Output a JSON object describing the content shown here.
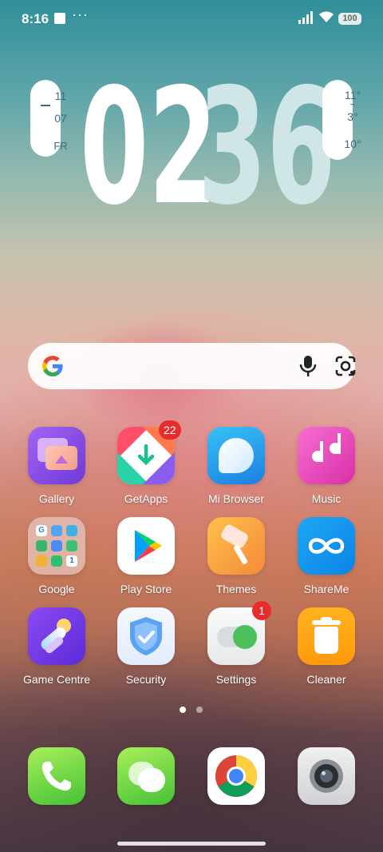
{
  "status_bar": {
    "time": "8:16",
    "more": "···",
    "battery": "100"
  },
  "clock_widget": {
    "date_month": "11",
    "date_day": "07",
    "weekday": "FR",
    "hour": "02",
    "minute": "36",
    "temp_high": "11°",
    "temp_sep": "~",
    "temp_low": "3°",
    "temp_now": "10°"
  },
  "search_bar": {
    "icons": [
      "google-logo",
      "mic-icon",
      "lens-icon"
    ]
  },
  "apps": [
    {
      "label": "Gallery"
    },
    {
      "label": "GetApps",
      "badge": "22"
    },
    {
      "label": "Mi Browser"
    },
    {
      "label": "Music"
    },
    {
      "label": "Google"
    },
    {
      "label": "Play Store"
    },
    {
      "label": "Themes"
    },
    {
      "label": "ShareMe"
    },
    {
      "label": "Game Centre"
    },
    {
      "label": "Security"
    },
    {
      "label": "Settings",
      "badge": "1"
    },
    {
      "label": "Cleaner"
    }
  ],
  "dock": [
    {
      "icon": "phone-icon"
    },
    {
      "icon": "messages-icon"
    },
    {
      "icon": "chrome-icon"
    },
    {
      "icon": "camera-icon"
    }
  ],
  "page_indicator": {
    "pages": 2,
    "active": 1
  },
  "colors": {
    "badge": "#e82b2b",
    "clock_hour": "#ffffff",
    "clock_minute": "#cfe5e6",
    "widget_text": "#3f6c7a"
  }
}
